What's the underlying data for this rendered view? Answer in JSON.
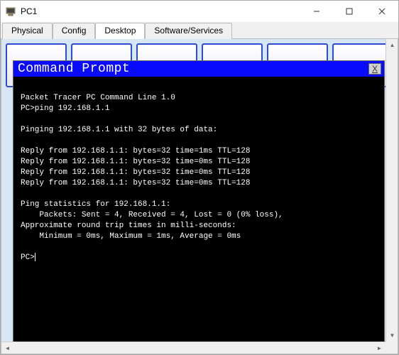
{
  "window": {
    "title": "PC1"
  },
  "tabs": {
    "physical": "Physical",
    "config": "Config",
    "desktop": "Desktop",
    "software": "Software/Services"
  },
  "terminal": {
    "title": "Command Prompt",
    "close_label": "X",
    "lines": {
      "l0": "",
      "l1": "Packet Tracer PC Command Line 1.0",
      "l2": "PC>ping 192.168.1.1",
      "l3": "",
      "l4": "Pinging 192.168.1.1 with 32 bytes of data:",
      "l5": "",
      "l6": "Reply from 192.168.1.1: bytes=32 time=1ms TTL=128",
      "l7": "Reply from 192.168.1.1: bytes=32 time=0ms TTL=128",
      "l8": "Reply from 192.168.1.1: bytes=32 time=0ms TTL=128",
      "l9": "Reply from 192.168.1.1: bytes=32 time=0ms TTL=128",
      "l10": "",
      "l11": "Ping statistics for 192.168.1.1:",
      "l12": "    Packets: Sent = 4, Received = 4, Lost = 0 (0% loss),",
      "l13": "Approximate round trip times in milli-seconds:",
      "l14": "    Minimum = 0ms, Maximum = 1ms, Average = 0ms",
      "l15": "",
      "prompt": "PC>"
    }
  }
}
